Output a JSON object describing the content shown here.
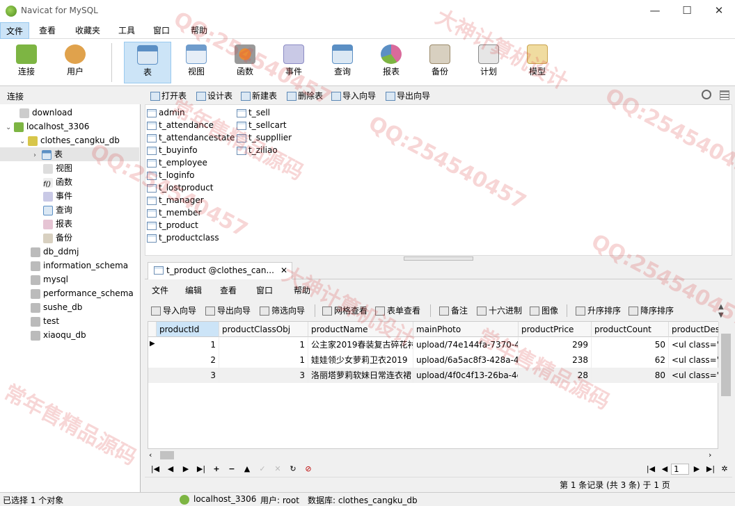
{
  "window": {
    "title": "Navicat for MySQL",
    "controls": [
      "—",
      "☐",
      "✕"
    ]
  },
  "menu": [
    "文件",
    "查看",
    "收藏夹",
    "工具",
    "窗口",
    "帮助"
  ],
  "toolbar": [
    {
      "label": "连接",
      "icon": "connection-icon",
      "color": "#7db543"
    },
    {
      "label": "用户",
      "icon": "user-icon",
      "color": "#e0a24c"
    },
    {
      "label": "表",
      "icon": "table-icon",
      "color": "#5b8fc4"
    },
    {
      "label": "视图",
      "icon": "view-icon",
      "color": "#6f9ccc"
    },
    {
      "label": "函数",
      "icon": "function-icon",
      "color": "#e98c35"
    },
    {
      "label": "事件",
      "icon": "event-icon",
      "color": "#8b8bc4"
    },
    {
      "label": "查询",
      "icon": "query-icon",
      "color": "#5b8fc4"
    },
    {
      "label": "报表",
      "icon": "report-icon",
      "color": "#d96a9b"
    },
    {
      "label": "备份",
      "icon": "backup-icon",
      "color": "#9b8a6a"
    },
    {
      "label": "计划",
      "icon": "schedule-icon",
      "color": "#8a8a8a"
    },
    {
      "label": "模型",
      "icon": "model-icon",
      "color": "#c9a24c"
    }
  ],
  "subbar": {
    "section": "连接",
    "actions": [
      "打开表",
      "设计表",
      "新建表",
      "删除表",
      "导入向导",
      "导出向导"
    ]
  },
  "tree": [
    {
      "label": "download",
      "indent": 0,
      "arrow": ""
    },
    {
      "label": "localhost_3306",
      "indent": 0,
      "arrow": "⌄"
    },
    {
      "label": "clothes_cangku_db",
      "indent": 1,
      "arrow": "⌄"
    },
    {
      "label": "表",
      "indent": 2,
      "arrow": "›"
    },
    {
      "label": "视图",
      "indent": 2,
      "arrow": ""
    },
    {
      "label": "函数",
      "indent": 2,
      "arrow": ""
    },
    {
      "label": "事件",
      "indent": 2,
      "arrow": ""
    },
    {
      "label": "查询",
      "indent": 2,
      "arrow": ""
    },
    {
      "label": "报表",
      "indent": 2,
      "arrow": ""
    },
    {
      "label": "备份",
      "indent": 2,
      "arrow": ""
    },
    {
      "label": "db_ddmj",
      "indent": 1,
      "arrow": ""
    },
    {
      "label": "information_schema",
      "indent": 1,
      "arrow": ""
    },
    {
      "label": "mysql",
      "indent": 1,
      "arrow": ""
    },
    {
      "label": "performance_schema",
      "indent": 1,
      "arrow": ""
    },
    {
      "label": "sushe_db",
      "indent": 1,
      "arrow": ""
    },
    {
      "label": "test",
      "indent": 1,
      "arrow": ""
    },
    {
      "label": "xiaoqu_db",
      "indent": 1,
      "arrow": ""
    }
  ],
  "tables_col1": [
    "admin",
    "t_attendance",
    "t_attendancestate",
    "t_buyinfo",
    "t_employee",
    "t_loginfo",
    "t_lostproduct",
    "t_manager",
    "t_member",
    "t_product",
    "t_productclass"
  ],
  "tables_col2": [
    "t_sell",
    "t_sellcart",
    "t_suppllier",
    "t_ziliao"
  ],
  "tab": {
    "title": "t_product @clothes_can...",
    "close": "✕"
  },
  "objmenu": [
    "文件",
    "编辑",
    "查看",
    "窗口",
    "帮助"
  ],
  "objtools": [
    "导入向导",
    "导出向导",
    "筛选向导",
    "网格查看",
    "表单查看",
    "备注",
    "十六进制",
    "图像",
    "升序排序",
    "降序排序"
  ],
  "grid": {
    "columns": [
      "productId",
      "productClassObj",
      "productName",
      "mainPhoto",
      "productPrice",
      "productCount",
      "productDes"
    ],
    "rows": [
      [
        "1",
        "1",
        "公主家2019春装复古碎花衬",
        "upload/74e144fa-7370-4(",
        "299",
        "50",
        "<ul class=\"a"
      ],
      [
        "2",
        "1",
        "娃娃领少女萝莉卫衣2019",
        "upload/6a5ac8f3-428a-42",
        "238",
        "62",
        "<ul class=\"a"
      ],
      [
        "3",
        "3",
        "洛丽塔萝莉软妹日常连衣裙",
        "upload/4f0c4f13-26ba-4c",
        "28",
        "80",
        "<ul class=\"a"
      ]
    ]
  },
  "nav": {
    "page": "1",
    "record_info": "第 1 条记录 (共 3 条) 于 1 页"
  },
  "status": {
    "selection": "已选择 1 个对象",
    "connection": "localhost_3306",
    "user": "用户: root",
    "database": "数据库: clothes_cangku_db"
  },
  "watermarks": [
    "QQ:254540457",
    "大神计算机设计",
    "常年售精品源码"
  ]
}
